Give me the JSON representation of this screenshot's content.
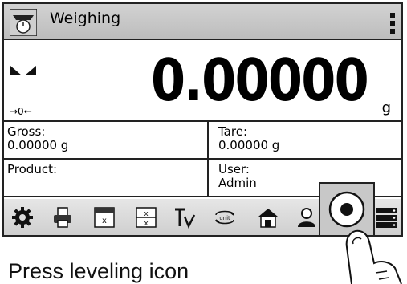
{
  "header": {
    "title": "Weighing"
  },
  "reading": {
    "value": "0.00000",
    "unit": "g",
    "zero_indicator": "→0←"
  },
  "info": {
    "gross_label": "Gross:",
    "gross_value": "0.00000 g",
    "tare_label": "Tare:",
    "tare_value": "0.00000 g",
    "product_label": "Product:",
    "product_value": "",
    "user_label": "User:",
    "user_value": "Admin"
  },
  "toolbar": {
    "icons": [
      "gear-icon",
      "printer-icon",
      "tare-window-icon",
      "tare-clear-icon",
      "tare-set-icon",
      "unit-change-icon",
      "home-icon",
      "user-icon",
      "leveling-icon",
      "database-icon"
    ]
  },
  "caption": "Press leveling icon"
}
